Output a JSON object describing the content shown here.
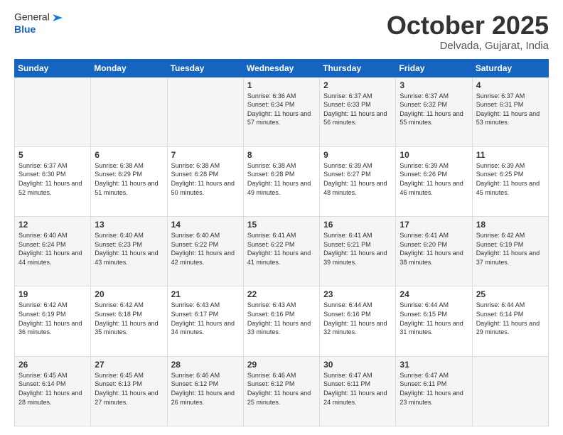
{
  "header": {
    "logo_general": "General",
    "logo_blue": "Blue",
    "month": "October 2025",
    "location": "Delvada, Gujarat, India"
  },
  "weekdays": [
    "Sunday",
    "Monday",
    "Tuesday",
    "Wednesday",
    "Thursday",
    "Friday",
    "Saturday"
  ],
  "weeks": [
    [
      {
        "day": "",
        "sunrise": "",
        "sunset": "",
        "daylight": ""
      },
      {
        "day": "",
        "sunrise": "",
        "sunset": "",
        "daylight": ""
      },
      {
        "day": "",
        "sunrise": "",
        "sunset": "",
        "daylight": ""
      },
      {
        "day": "1",
        "sunrise": "Sunrise: 6:36 AM",
        "sunset": "Sunset: 6:34 PM",
        "daylight": "Daylight: 11 hours and 57 minutes."
      },
      {
        "day": "2",
        "sunrise": "Sunrise: 6:37 AM",
        "sunset": "Sunset: 6:33 PM",
        "daylight": "Daylight: 11 hours and 56 minutes."
      },
      {
        "day": "3",
        "sunrise": "Sunrise: 6:37 AM",
        "sunset": "Sunset: 6:32 PM",
        "daylight": "Daylight: 11 hours and 55 minutes."
      },
      {
        "day": "4",
        "sunrise": "Sunrise: 6:37 AM",
        "sunset": "Sunset: 6:31 PM",
        "daylight": "Daylight: 11 hours and 53 minutes."
      }
    ],
    [
      {
        "day": "5",
        "sunrise": "Sunrise: 6:37 AM",
        "sunset": "Sunset: 6:30 PM",
        "daylight": "Daylight: 11 hours and 52 minutes."
      },
      {
        "day": "6",
        "sunrise": "Sunrise: 6:38 AM",
        "sunset": "Sunset: 6:29 PM",
        "daylight": "Daylight: 11 hours and 51 minutes."
      },
      {
        "day": "7",
        "sunrise": "Sunrise: 6:38 AM",
        "sunset": "Sunset: 6:28 PM",
        "daylight": "Daylight: 11 hours and 50 minutes."
      },
      {
        "day": "8",
        "sunrise": "Sunrise: 6:38 AM",
        "sunset": "Sunset: 6:28 PM",
        "daylight": "Daylight: 11 hours and 49 minutes."
      },
      {
        "day": "9",
        "sunrise": "Sunrise: 6:39 AM",
        "sunset": "Sunset: 6:27 PM",
        "daylight": "Daylight: 11 hours and 48 minutes."
      },
      {
        "day": "10",
        "sunrise": "Sunrise: 6:39 AM",
        "sunset": "Sunset: 6:26 PM",
        "daylight": "Daylight: 11 hours and 46 minutes."
      },
      {
        "day": "11",
        "sunrise": "Sunrise: 6:39 AM",
        "sunset": "Sunset: 6:25 PM",
        "daylight": "Daylight: 11 hours and 45 minutes."
      }
    ],
    [
      {
        "day": "12",
        "sunrise": "Sunrise: 6:40 AM",
        "sunset": "Sunset: 6:24 PM",
        "daylight": "Daylight: 11 hours and 44 minutes."
      },
      {
        "day": "13",
        "sunrise": "Sunrise: 6:40 AM",
        "sunset": "Sunset: 6:23 PM",
        "daylight": "Daylight: 11 hours and 43 minutes."
      },
      {
        "day": "14",
        "sunrise": "Sunrise: 6:40 AM",
        "sunset": "Sunset: 6:22 PM",
        "daylight": "Daylight: 11 hours and 42 minutes."
      },
      {
        "day": "15",
        "sunrise": "Sunrise: 6:41 AM",
        "sunset": "Sunset: 6:22 PM",
        "daylight": "Daylight: 11 hours and 41 minutes."
      },
      {
        "day": "16",
        "sunrise": "Sunrise: 6:41 AM",
        "sunset": "Sunset: 6:21 PM",
        "daylight": "Daylight: 11 hours and 39 minutes."
      },
      {
        "day": "17",
        "sunrise": "Sunrise: 6:41 AM",
        "sunset": "Sunset: 6:20 PM",
        "daylight": "Daylight: 11 hours and 38 minutes."
      },
      {
        "day": "18",
        "sunrise": "Sunrise: 6:42 AM",
        "sunset": "Sunset: 6:19 PM",
        "daylight": "Daylight: 11 hours and 37 minutes."
      }
    ],
    [
      {
        "day": "19",
        "sunrise": "Sunrise: 6:42 AM",
        "sunset": "Sunset: 6:19 PM",
        "daylight": "Daylight: 11 hours and 36 minutes."
      },
      {
        "day": "20",
        "sunrise": "Sunrise: 6:42 AM",
        "sunset": "Sunset: 6:18 PM",
        "daylight": "Daylight: 11 hours and 35 minutes."
      },
      {
        "day": "21",
        "sunrise": "Sunrise: 6:43 AM",
        "sunset": "Sunset: 6:17 PM",
        "daylight": "Daylight: 11 hours and 34 minutes."
      },
      {
        "day": "22",
        "sunrise": "Sunrise: 6:43 AM",
        "sunset": "Sunset: 6:16 PM",
        "daylight": "Daylight: 11 hours and 33 minutes."
      },
      {
        "day": "23",
        "sunrise": "Sunrise: 6:44 AM",
        "sunset": "Sunset: 6:16 PM",
        "daylight": "Daylight: 11 hours and 32 minutes."
      },
      {
        "day": "24",
        "sunrise": "Sunrise: 6:44 AM",
        "sunset": "Sunset: 6:15 PM",
        "daylight": "Daylight: 11 hours and 31 minutes."
      },
      {
        "day": "25",
        "sunrise": "Sunrise: 6:44 AM",
        "sunset": "Sunset: 6:14 PM",
        "daylight": "Daylight: 11 hours and 29 minutes."
      }
    ],
    [
      {
        "day": "26",
        "sunrise": "Sunrise: 6:45 AM",
        "sunset": "Sunset: 6:14 PM",
        "daylight": "Daylight: 11 hours and 28 minutes."
      },
      {
        "day": "27",
        "sunrise": "Sunrise: 6:45 AM",
        "sunset": "Sunset: 6:13 PM",
        "daylight": "Daylight: 11 hours and 27 minutes."
      },
      {
        "day": "28",
        "sunrise": "Sunrise: 6:46 AM",
        "sunset": "Sunset: 6:12 PM",
        "daylight": "Daylight: 11 hours and 26 minutes."
      },
      {
        "day": "29",
        "sunrise": "Sunrise: 6:46 AM",
        "sunset": "Sunset: 6:12 PM",
        "daylight": "Daylight: 11 hours and 25 minutes."
      },
      {
        "day": "30",
        "sunrise": "Sunrise: 6:47 AM",
        "sunset": "Sunset: 6:11 PM",
        "daylight": "Daylight: 11 hours and 24 minutes."
      },
      {
        "day": "31",
        "sunrise": "Sunrise: 6:47 AM",
        "sunset": "Sunset: 6:11 PM",
        "daylight": "Daylight: 11 hours and 23 minutes."
      },
      {
        "day": "",
        "sunrise": "",
        "sunset": "",
        "daylight": ""
      }
    ]
  ]
}
